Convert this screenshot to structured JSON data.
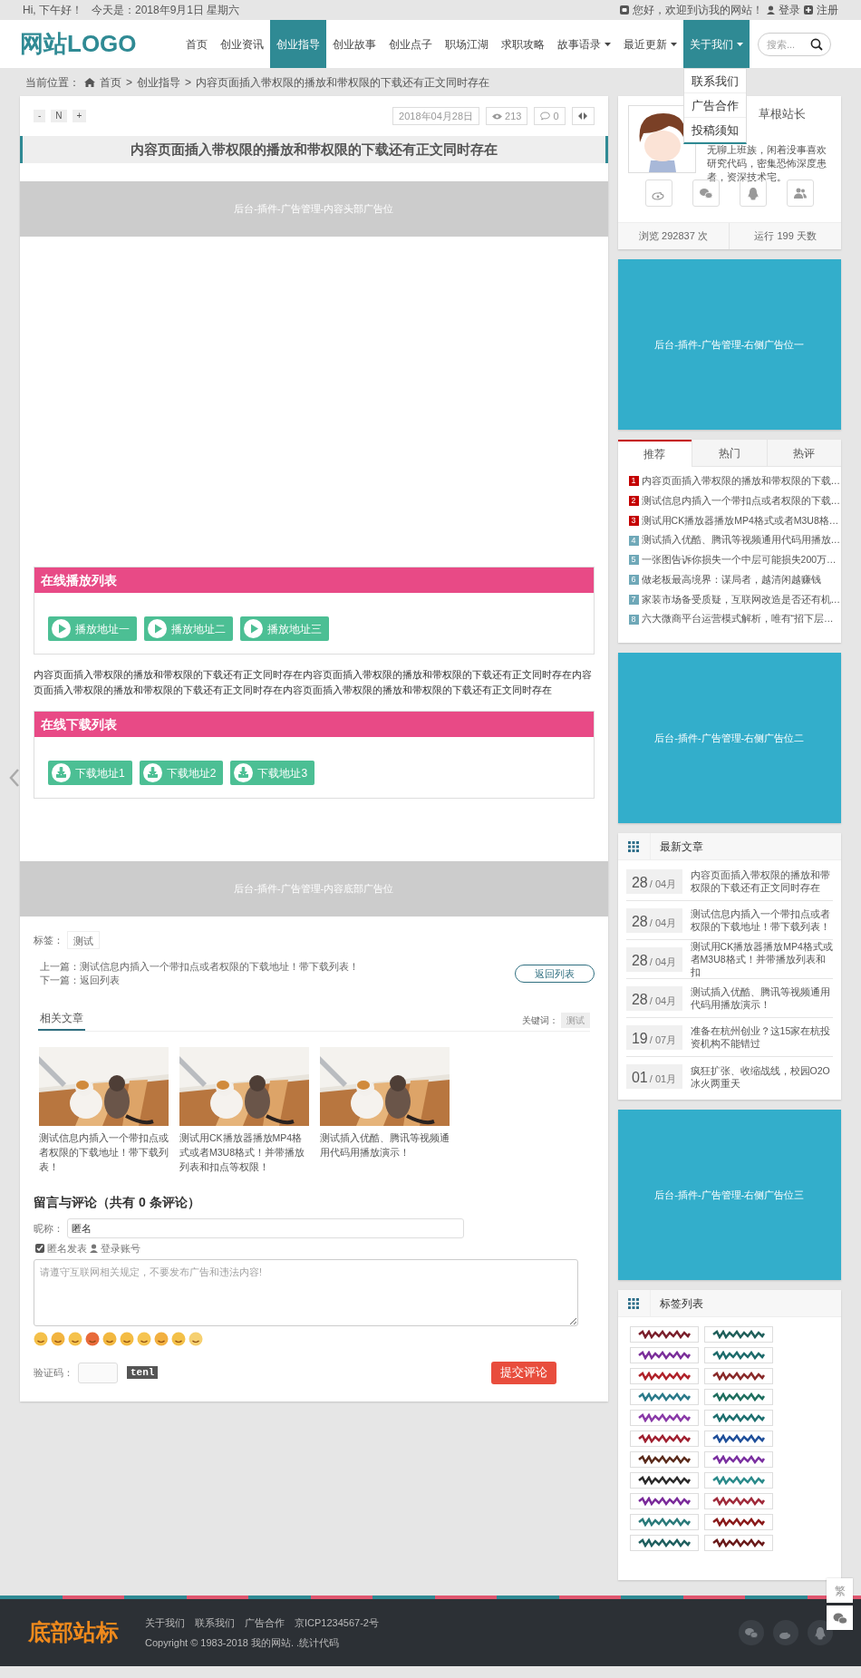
{
  "top_bar": {
    "greeting": "Hi, 下午好！",
    "date": "今天是：2018年9月1日 星期六",
    "welcome": "您好，欢迎到访我的网站！",
    "login": "登录",
    "register": "注册"
  },
  "header": {
    "logo": "网站LOGO",
    "nav": [
      {
        "label": "首页",
        "selected": false,
        "has_menu": false,
        "expanded": false
      },
      {
        "label": "创业资讯",
        "selected": false,
        "has_menu": false,
        "expanded": false
      },
      {
        "label": "创业指导",
        "selected": true,
        "has_menu": false,
        "expanded": false
      },
      {
        "label": "创业故事",
        "selected": false,
        "has_menu": false,
        "expanded": false
      },
      {
        "label": "创业点子",
        "selected": false,
        "has_menu": false,
        "expanded": false
      },
      {
        "label": "职场江湖",
        "selected": false,
        "has_menu": false,
        "expanded": false
      },
      {
        "label": "求职攻略",
        "selected": false,
        "has_menu": false,
        "expanded": false
      },
      {
        "label": "故事语录",
        "selected": false,
        "has_menu": true,
        "expanded": false
      },
      {
        "label": "最近更新",
        "selected": false,
        "has_menu": true,
        "expanded": false
      },
      {
        "label": "关于我们",
        "selected": true,
        "has_menu": true,
        "expanded": true
      }
    ],
    "menu": [
      "联系我们",
      "广告合作",
      "投稿须知"
    ],
    "search": {
      "placeholder": "搜索..."
    }
  },
  "breadcrumb": {
    "label": "当前位置：",
    "separators": [
      ">",
      ">"
    ],
    "items": [
      "首页",
      "创业指导",
      "内容页面插入带权限的播放和带权限的下载还有正文同时存在"
    ]
  },
  "article": {
    "font_buttons": [
      "-",
      "N",
      "+"
    ],
    "date": "2018年04月28日",
    "views": "213",
    "comments": "0",
    "title": "内容页面插入带权限的播放和带权限的下载还有正文同时存在",
    "ad_top": "后台-插件-广告管理-内容头部广告位",
    "play_list": {
      "title": "在线播放列表",
      "items": [
        "播放地址一",
        "播放地址二",
        "播放地址三"
      ]
    },
    "body": "内容页面插入带权限的播放和带权限的下载还有正文同时存在内容页面插入带权限的播放和带权限的下载还有正文同时存在内容页面插入带权限的播放和带权限的下载还有正文同时存在内容页面插入带权限的播放和带权限的下载还有正文同时存在",
    "download_list": {
      "title": "在线下载列表",
      "items": [
        "下载地址1",
        "下载地址2",
        "下载地址3"
      ]
    },
    "ad_bottom": "后台-插件-广告管理-内容底部广告位",
    "tags_label": "标签：",
    "tags": [
      "测试"
    ],
    "prev": "上一篇：测试信息内插入一个带扣点或者权限的下载地址！带下载列表！",
    "next": "下一篇：返回列表",
    "back_button": "返回列表",
    "related": {
      "title": "相关文章",
      "keyword_label": "关键词：",
      "keyword": "测试",
      "items": [
        {
          "title": "测试信息内插入一个带扣点或者权限的下载地址！带下载列表！"
        },
        {
          "title": "测试用CK播放器播放MP4格式或者M3U8格式！并带播放列表和扣点等权限！"
        },
        {
          "title": "测试插入优酷、腾讯等视频通用代码用播放演示！"
        }
      ]
    }
  },
  "comments": {
    "title": "留言与评论（共有 0 条评论）",
    "nick_label": "昵称：",
    "nick_value": "匿名",
    "anonymous": {
      "label": "匿名发表",
      "checked": true
    },
    "login_link": "登录账号",
    "placeholder": "请遵守互联网相关规定，不要发布广告和违法内容!",
    "captcha_label": "验证码：",
    "captcha_image": "tenl",
    "submit": "提交评论"
  },
  "sidebar": {
    "profile": {
      "name": "草根站长",
      "bio": "无聊上班族，闲着没事喜欢研究代码，密集恐怖深度患者，资深技术宅。",
      "stats": [
        "浏览 292837 次",
        "运行 199 天数"
      ]
    },
    "ad_1": "后台-插件-广告管理-右侧广告位一",
    "tabs": [
      {
        "label": "推荐",
        "selected": true
      },
      {
        "label": "热门",
        "selected": false
      },
      {
        "label": "热评",
        "selected": false
      }
    ],
    "tab_items": [
      {
        "rank": "1",
        "color": "#c40000",
        "title": "内容页面插入带权限的播放和带权限的下载…"
      },
      {
        "rank": "2",
        "color": "#c40000",
        "title": "测试信息内插入一个带扣点或者权限的下载…"
      },
      {
        "rank": "3",
        "color": "#c40000",
        "title": "测试用CK播放器播放MP4格式或者M3U8格…"
      },
      {
        "rank": "4",
        "color": "#6fa8b8",
        "title": "测试插入优酷、腾讯等视频通用代码用播放…"
      },
      {
        "rank": "5",
        "color": "#6fa8b8",
        "title": "一张图告诉你损失一个中层可能损失200万…"
      },
      {
        "rank": "6",
        "color": "#6fa8b8",
        "title": "做老板最高境界：谋局者，越清闲越赚钱"
      },
      {
        "rank": "7",
        "color": "#6fa8b8",
        "title": "家装市场备受质疑，互联网改造是否还有机…"
      },
      {
        "rank": "8",
        "color": "#6fa8b8",
        "title": "六大微商平台运营模式解析，唯有“招下层…"
      }
    ],
    "ad_2": "后台-插件-广告管理-右侧广告位二",
    "latest": {
      "title": "最新文章",
      "items": [
        {
          "day": "28",
          "month": "/ 04月",
          "title": "内容页面插入带权限的播放和带权限的下载还有正文同时存在"
        },
        {
          "day": "28",
          "month": "/ 04月",
          "title": "测试信息内插入一个带扣点或者权限的下载地址！带下载列表！"
        },
        {
          "day": "28",
          "month": "/ 04月",
          "title": "测试用CK播放器播放MP4格式或者M3U8格式！并带播放列表和扣"
        },
        {
          "day": "28",
          "month": "/ 04月",
          "title": "测试插入优酷、腾讯等视频通用代码用播放演示！"
        },
        {
          "day": "19",
          "month": "/ 07月",
          "title": "准备在杭州创业？这15家在杭投资机构不能错过"
        },
        {
          "day": "01",
          "month": "/ 01月",
          "title": "疯狂扩张、收缩战线，校园O2O冰火两重天"
        }
      ]
    },
    "ad_3": "后台-插件-广告管理-右侧广告位三",
    "tag_list": {
      "title": "标签列表",
      "tags": [
        {
          "color": "#7a1f2b"
        },
        {
          "color": "#1f5f5a"
        },
        {
          "color": "#7b2f9a"
        },
        {
          "color": "#1d6b6b"
        },
        {
          "color": "#b0222a"
        },
        {
          "color": "#8a2a2a"
        },
        {
          "color": "#2a7a8a"
        },
        {
          "color": "#1f6f5f"
        },
        {
          "color": "#8a3aa8"
        },
        {
          "color": "#1e7070"
        },
        {
          "color": "#a02030"
        },
        {
          "color": "#1f4f9a"
        },
        {
          "color": "#5a2a1a"
        },
        {
          "color": "#7a2fa0"
        },
        {
          "color": "#2a2a2a"
        },
        {
          "color": "#2a8a8a"
        },
        {
          "color": "#7a2a9a"
        },
        {
          "color": "#a02a3a"
        },
        {
          "color": "#2a7a7a"
        },
        {
          "color": "#8a1a1a"
        },
        {
          "color": "#1f5f5f"
        },
        {
          "color": "#6a1a1a"
        }
      ]
    }
  },
  "side_buttons": {
    "traditional": "繁"
  },
  "footer": {
    "logo": "底部站标",
    "links": [
      "关于我们",
      "联系我们",
      "广告合作",
      "京ICP1234567-2号"
    ],
    "copyright": "Copyright © 1983-2018 我的网站. .统计代码"
  }
}
